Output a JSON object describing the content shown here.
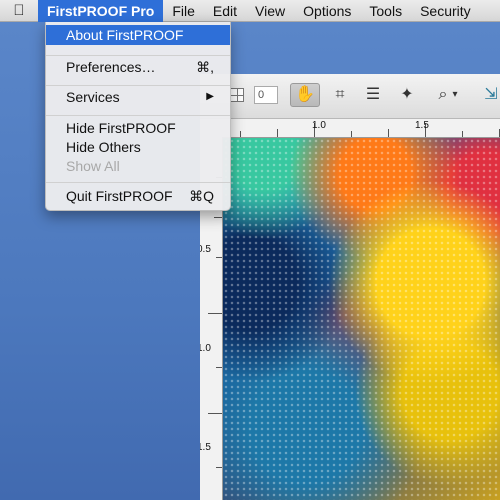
{
  "menubar": {
    "apple_icon": "apple-icon",
    "items": [
      "FirstPROOF Pro",
      "File",
      "Edit",
      "View",
      "Options",
      "Tools",
      "Security"
    ]
  },
  "app_menu": {
    "about": "About FirstPROOF",
    "preferences": "Preferences…",
    "preferences_shortcut": "⌘,",
    "services": "Services",
    "services_arrow": "▶",
    "hide_app": "Hide FirstPROOF",
    "hide_others": "Hide Others",
    "show_all": "Show All",
    "quit": "Quit FirstPROOF",
    "quit_shortcut": "⌘Q"
  },
  "toolbar": {
    "page_field_value": "0",
    "hand_icon": "✋",
    "crop_icon": "⌗",
    "page_icon": "☰",
    "stamp_icon": "✦",
    "zoom_icon": "⌕",
    "zoom_dropdown": "▾",
    "fit_icon": "⇲"
  },
  "ruler_top": {
    "labels": [
      "1.0",
      "1.5"
    ]
  },
  "ruler_left": {
    "labels": [
      "0.5",
      "1.0",
      "1.5"
    ]
  },
  "colors": {
    "highlight": "#2e6fd8",
    "desktop": "#4c78bd"
  }
}
